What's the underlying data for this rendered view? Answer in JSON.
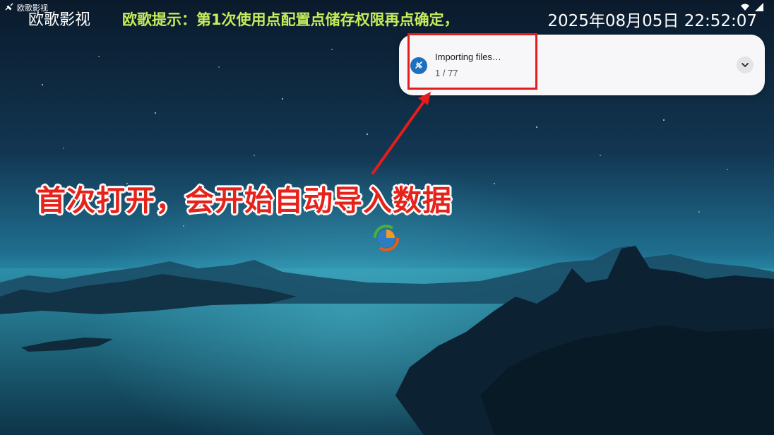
{
  "status_bar": {
    "app_label": "欧歌影视",
    "app_icon": "link-icon",
    "right_icons": [
      "wifi-icon",
      "signal-icon"
    ]
  },
  "header": {
    "app_title": "欧歌影视",
    "ticker_text": "欧歌提示：第1次使用点配置点储存权限再点确定，",
    "datetime": "2025年08月05日 22:52:07"
  },
  "notification": {
    "title": "Importing files…",
    "progress_text": "1 / 77",
    "icon": "link-icon",
    "expand_icon": "chevron-down-icon",
    "accent_color": "#1f6fbf"
  },
  "annotation": {
    "caption": "首次打开，会开始自动导入数据",
    "highlight_color": "#e51c1c"
  },
  "loader": {
    "icon": "loading-spinner-icon"
  }
}
